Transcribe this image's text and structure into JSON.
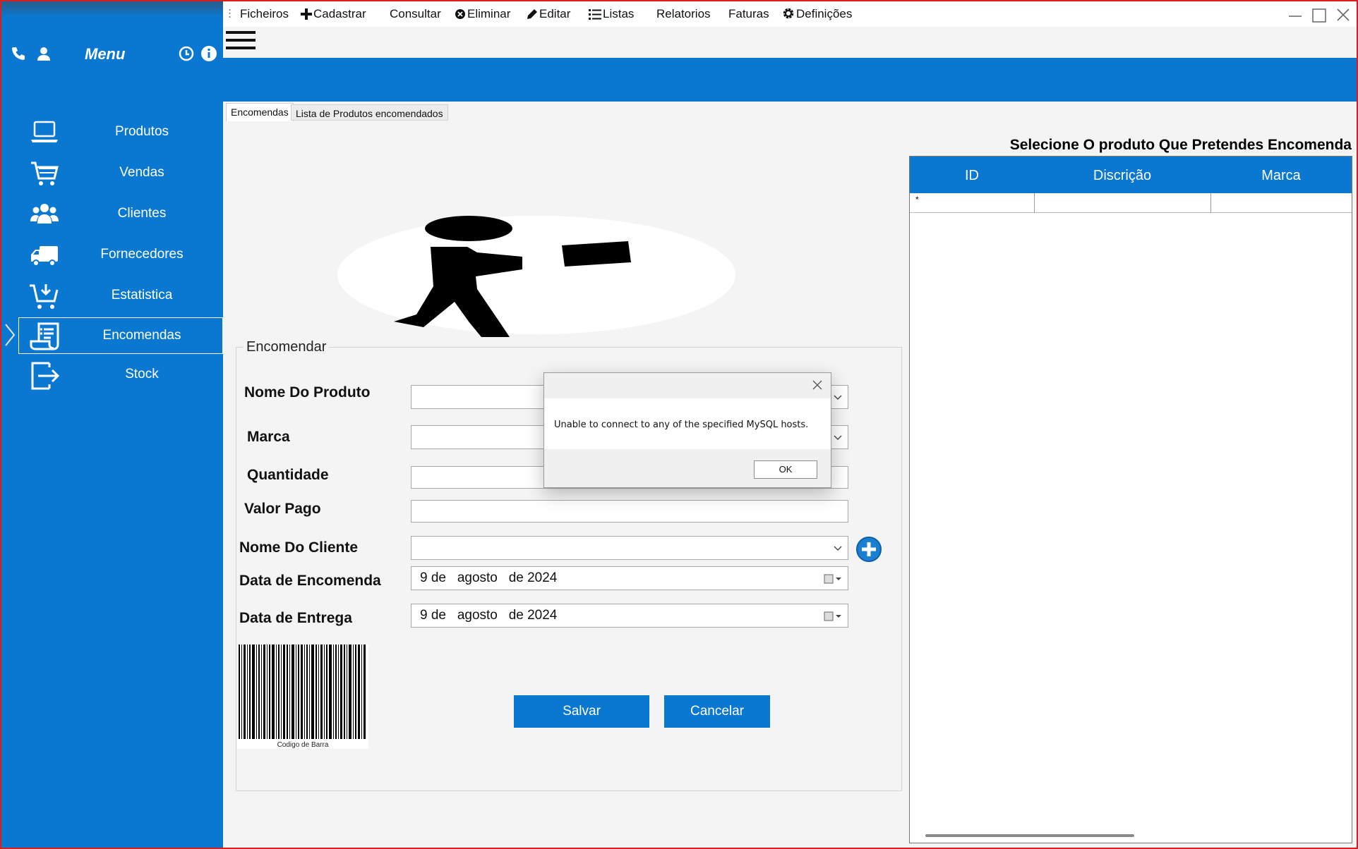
{
  "sidebar": {
    "menu_title": "Menu",
    "items": [
      {
        "label": "Produtos",
        "icon": "laptop-icon"
      },
      {
        "label": "Vendas",
        "icon": "cart-icon"
      },
      {
        "label": "Clientes",
        "icon": "users-icon"
      },
      {
        "label": "Fornecedores",
        "icon": "truck-icon"
      },
      {
        "label": "Estatistica",
        "icon": "cart-download-icon"
      },
      {
        "label": "Encomendas",
        "icon": "receipt-icon",
        "active": true
      },
      {
        "label": "Stock",
        "icon": "export-icon"
      }
    ]
  },
  "menubar": {
    "items": [
      "Ficheiros",
      "Cadastrar",
      "Consultar",
      "Eliminar",
      "Editar",
      "Listas",
      "Relatorios",
      "Faturas",
      "Definições"
    ]
  },
  "tabs": [
    "Encomendas",
    "Lista de Produtos encomendados"
  ],
  "right_panel": {
    "title": "Selecione O produto Que Pretendes Encomenda",
    "columns": [
      "ID",
      "Discrição",
      "Marca"
    ],
    "row_marker": "*"
  },
  "form": {
    "legend": "Encomendar",
    "labels": {
      "produto": "Nome Do Produto",
      "marca": "Marca",
      "quantidade": "Quantidade",
      "valor": "Valor Pago",
      "cliente": "Nome Do Cliente",
      "data_encomenda": "Data de Encomenda",
      "data_entrega": "Data de Entrega"
    },
    "data_encomenda_value": "9 de   agosto   de 2024",
    "data_entrega_value": "9 de   agosto   de 2024",
    "barcode_caption": "Codigo de Barra",
    "save_label": "Salvar",
    "cancel_label": "Cancelar"
  },
  "dialog": {
    "message": "Unable to connect to any of the specified MySQL hosts.",
    "ok_label": "OK"
  },
  "colors": {
    "accent": "#0a78d0",
    "frame": "#d81e1e"
  }
}
